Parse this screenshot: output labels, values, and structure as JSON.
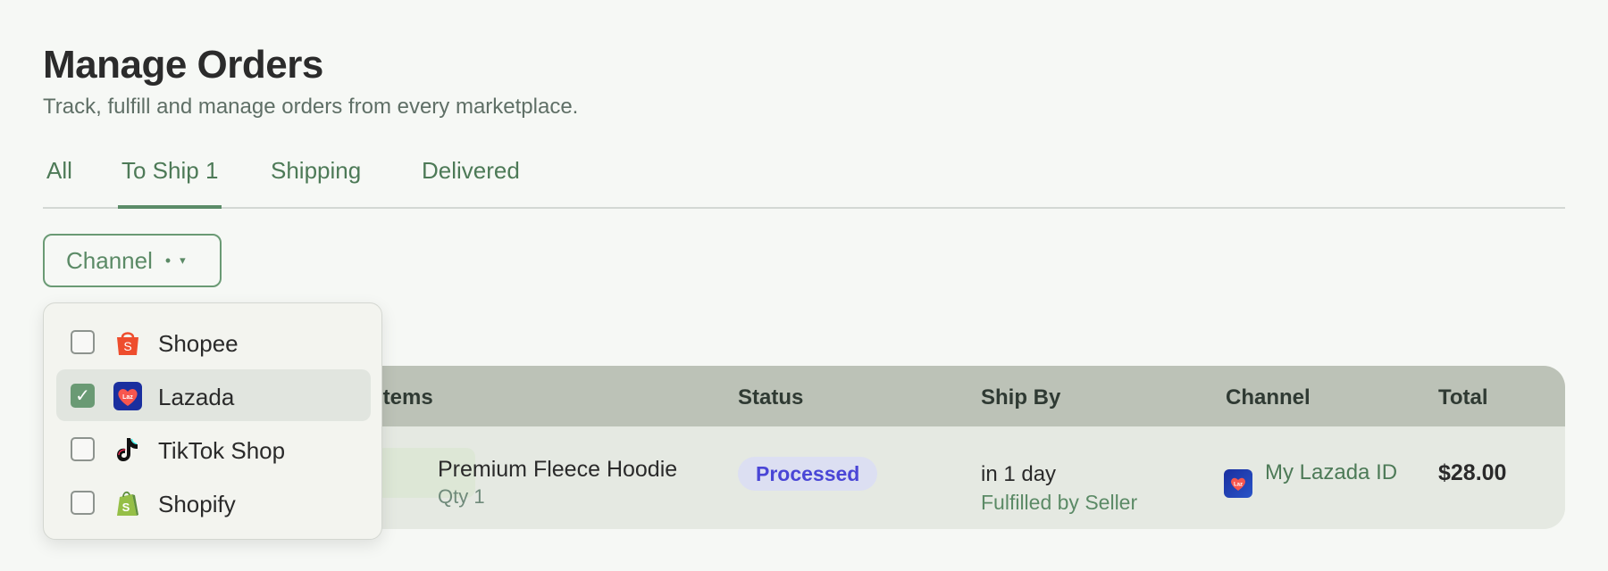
{
  "header": {
    "title": "Manage Orders",
    "subtitle": "Track, fulfill and manage orders from every marketplace."
  },
  "tabs": [
    {
      "label": "All",
      "active": false
    },
    {
      "label": "To Ship 1",
      "active": true
    },
    {
      "label": "Shipping",
      "active": false
    },
    {
      "label": "Delivered",
      "active": false
    }
  ],
  "filter": {
    "label": "Channel",
    "dot": "•",
    "caret": "▾",
    "options": [
      {
        "label": "Shopee",
        "checked": false,
        "icon": "shopee-icon"
      },
      {
        "label": "Lazada",
        "checked": true,
        "icon": "lazada-icon"
      },
      {
        "label": "TikTok Shop",
        "checked": false,
        "icon": "tiktok-icon"
      },
      {
        "label": "Shopify",
        "checked": false,
        "icon": "shopify-icon"
      }
    ],
    "checkmark": "✓"
  },
  "table": {
    "columns": [
      "Items",
      "Status",
      "Ship By",
      "Channel",
      "Total"
    ],
    "rows": [
      {
        "item_name": "Premium Fleece Hoodie",
        "item_qty": "Qty 1",
        "status": "Processed",
        "ship_by": "in 1 day",
        "fulfillment": "Fulfilled by Seller",
        "channel_name": "My Lazada ID",
        "channel_icon": "lazada-icon",
        "total": "$28.00"
      }
    ]
  },
  "colors": {
    "accent": "#5b8a66",
    "shopee": "#ee4d2d",
    "lazada": "#1a2f9f",
    "shopify": "#95bf47",
    "status_processed_bg": "#dcdff2",
    "status_processed_text": "#4a46d6"
  }
}
